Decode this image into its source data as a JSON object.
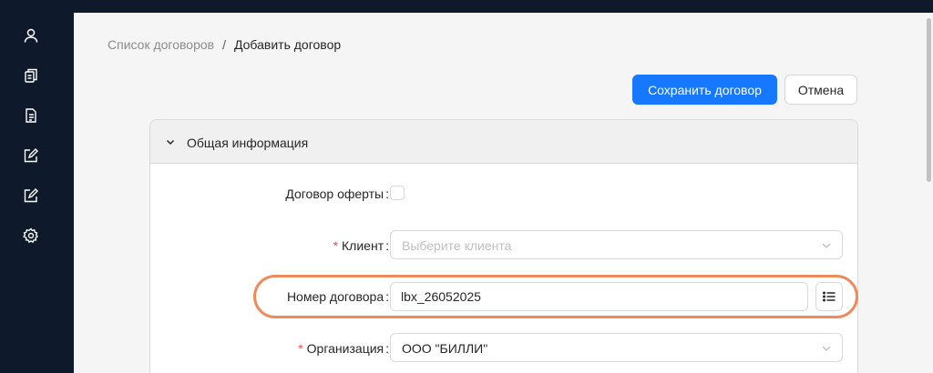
{
  "breadcrumb": {
    "parent": "Список договоров",
    "separator": "/",
    "current": "Добавить договор"
  },
  "actions": {
    "save_label": "Сохранить договор",
    "cancel_label": "Отмена"
  },
  "panel": {
    "title": "Общая информация",
    "expanded": true
  },
  "form": {
    "offer_contract": {
      "label": "Договор оферты",
      "checked": false
    },
    "client": {
      "label": "Клиент",
      "required": true,
      "placeholder": "Выберите клиента"
    },
    "contract_number": {
      "label": "Номер договора",
      "value": "lbx_26052025"
    },
    "organization": {
      "label": "Организация",
      "required": true,
      "value": "ООО \"БИЛЛИ\""
    }
  },
  "sidebar": {
    "icons": [
      "user-icon",
      "documents-icon",
      "document-list-icon",
      "edit-square-icon",
      "edit-square-icon",
      "gear-icon"
    ]
  },
  "colors": {
    "sidebar_bg": "#0e1a2b",
    "primary": "#1677ff",
    "required": "#ff4d4f",
    "highlight": "#f08a5d"
  }
}
